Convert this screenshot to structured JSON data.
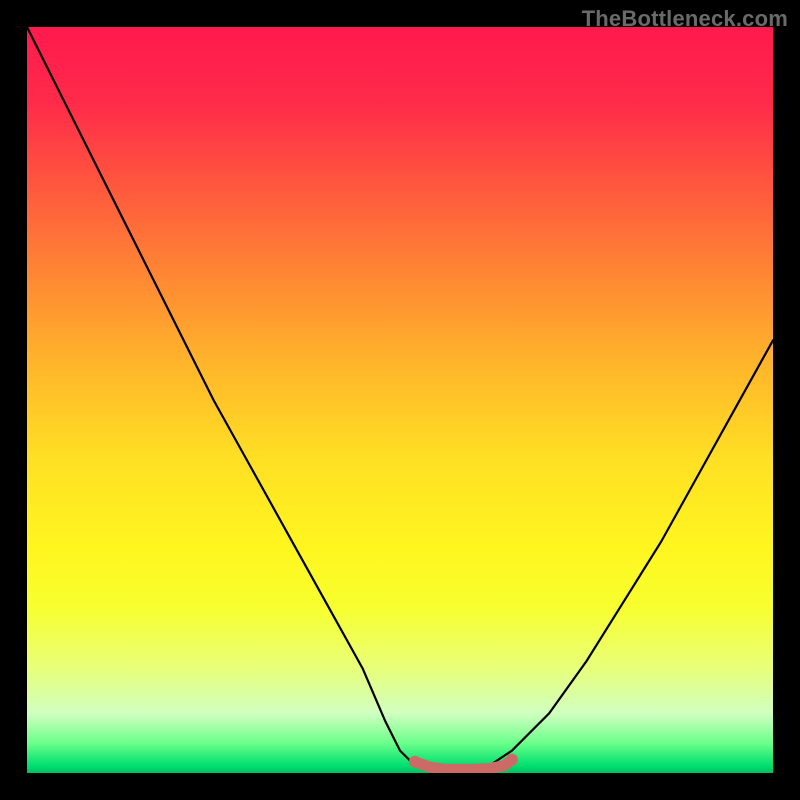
{
  "watermark": "TheBottleneck.com",
  "chart_data": {
    "type": "line",
    "title": "",
    "xlabel": "",
    "ylabel": "",
    "xlim": [
      0,
      100
    ],
    "ylim": [
      0,
      100
    ],
    "grid": false,
    "legend": false,
    "annotations": [],
    "series": [
      {
        "name": "bottleneck-curve",
        "color": "#000000",
        "x": [
          0,
          5,
          10,
          15,
          20,
          25,
          30,
          35,
          40,
          45,
          48,
          50,
          52,
          55,
          58,
          60,
          62,
          65,
          70,
          75,
          80,
          85,
          90,
          95,
          100
        ],
        "y": [
          100,
          90,
          80,
          70,
          60,
          50,
          41,
          32,
          23,
          14,
          7,
          3,
          1,
          0,
          0,
          0,
          1,
          3,
          8,
          15,
          23,
          31,
          40,
          49,
          58
        ]
      },
      {
        "name": "optimal-zone",
        "color": "#cc6b66",
        "x": [
          52,
          54,
          56,
          58,
          60,
          62,
          64,
          65
        ],
        "y": [
          1.5,
          0.8,
          0.5,
          0.5,
          0.5,
          0.6,
          1.0,
          1.8
        ]
      }
    ],
    "background_gradient": {
      "top": "#ff1a4d",
      "mid": "#ffe024",
      "bottom": "#00c060"
    }
  }
}
